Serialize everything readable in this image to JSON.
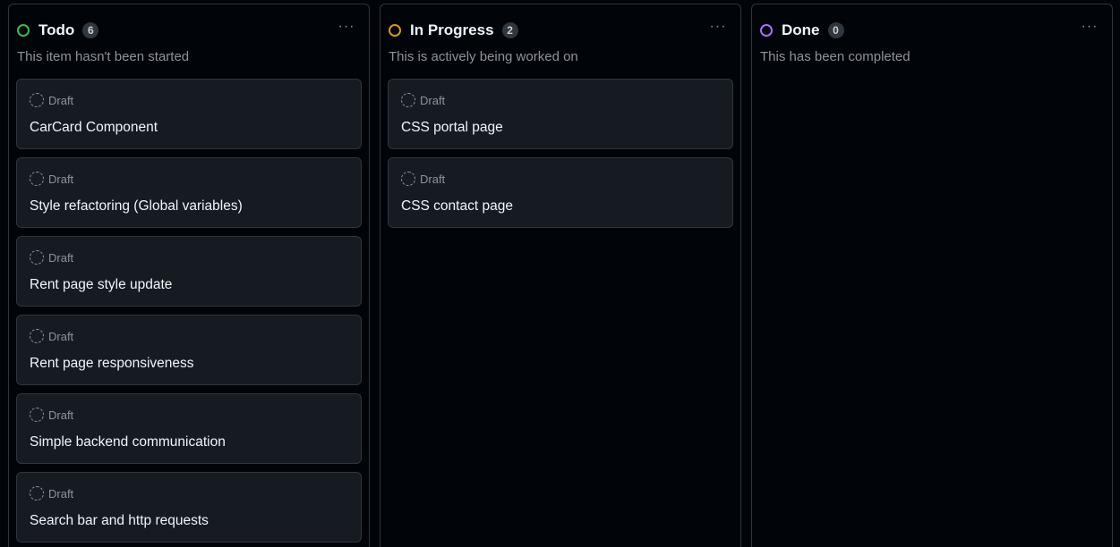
{
  "board": {
    "columns": [
      {
        "title": "Todo",
        "count": "6",
        "color": "#3fb950",
        "description": "This item hasn't been started",
        "more_label": "···",
        "cards": [
          {
            "meta": "Draft",
            "title": "CarCard Component"
          },
          {
            "meta": "Draft",
            "title": "Style refactoring (Global variables)"
          },
          {
            "meta": "Draft",
            "title": "Rent page style update"
          },
          {
            "meta": "Draft",
            "title": "Rent page responsiveness"
          },
          {
            "meta": "Draft",
            "title": "Simple backend communication"
          },
          {
            "meta": "Draft",
            "title": "Search bar and http requests"
          }
        ]
      },
      {
        "title": "In Progress",
        "count": "2",
        "color": "#d29922",
        "description": "This is actively being worked on",
        "more_label": "···",
        "cards": [
          {
            "meta": "Draft",
            "title": "CSS portal page"
          },
          {
            "meta": "Draft",
            "title": "CSS contact page"
          }
        ]
      },
      {
        "title": "Done",
        "count": "0",
        "color": "#a371f7",
        "description": "This has been completed",
        "more_label": "···",
        "cards": []
      }
    ]
  }
}
